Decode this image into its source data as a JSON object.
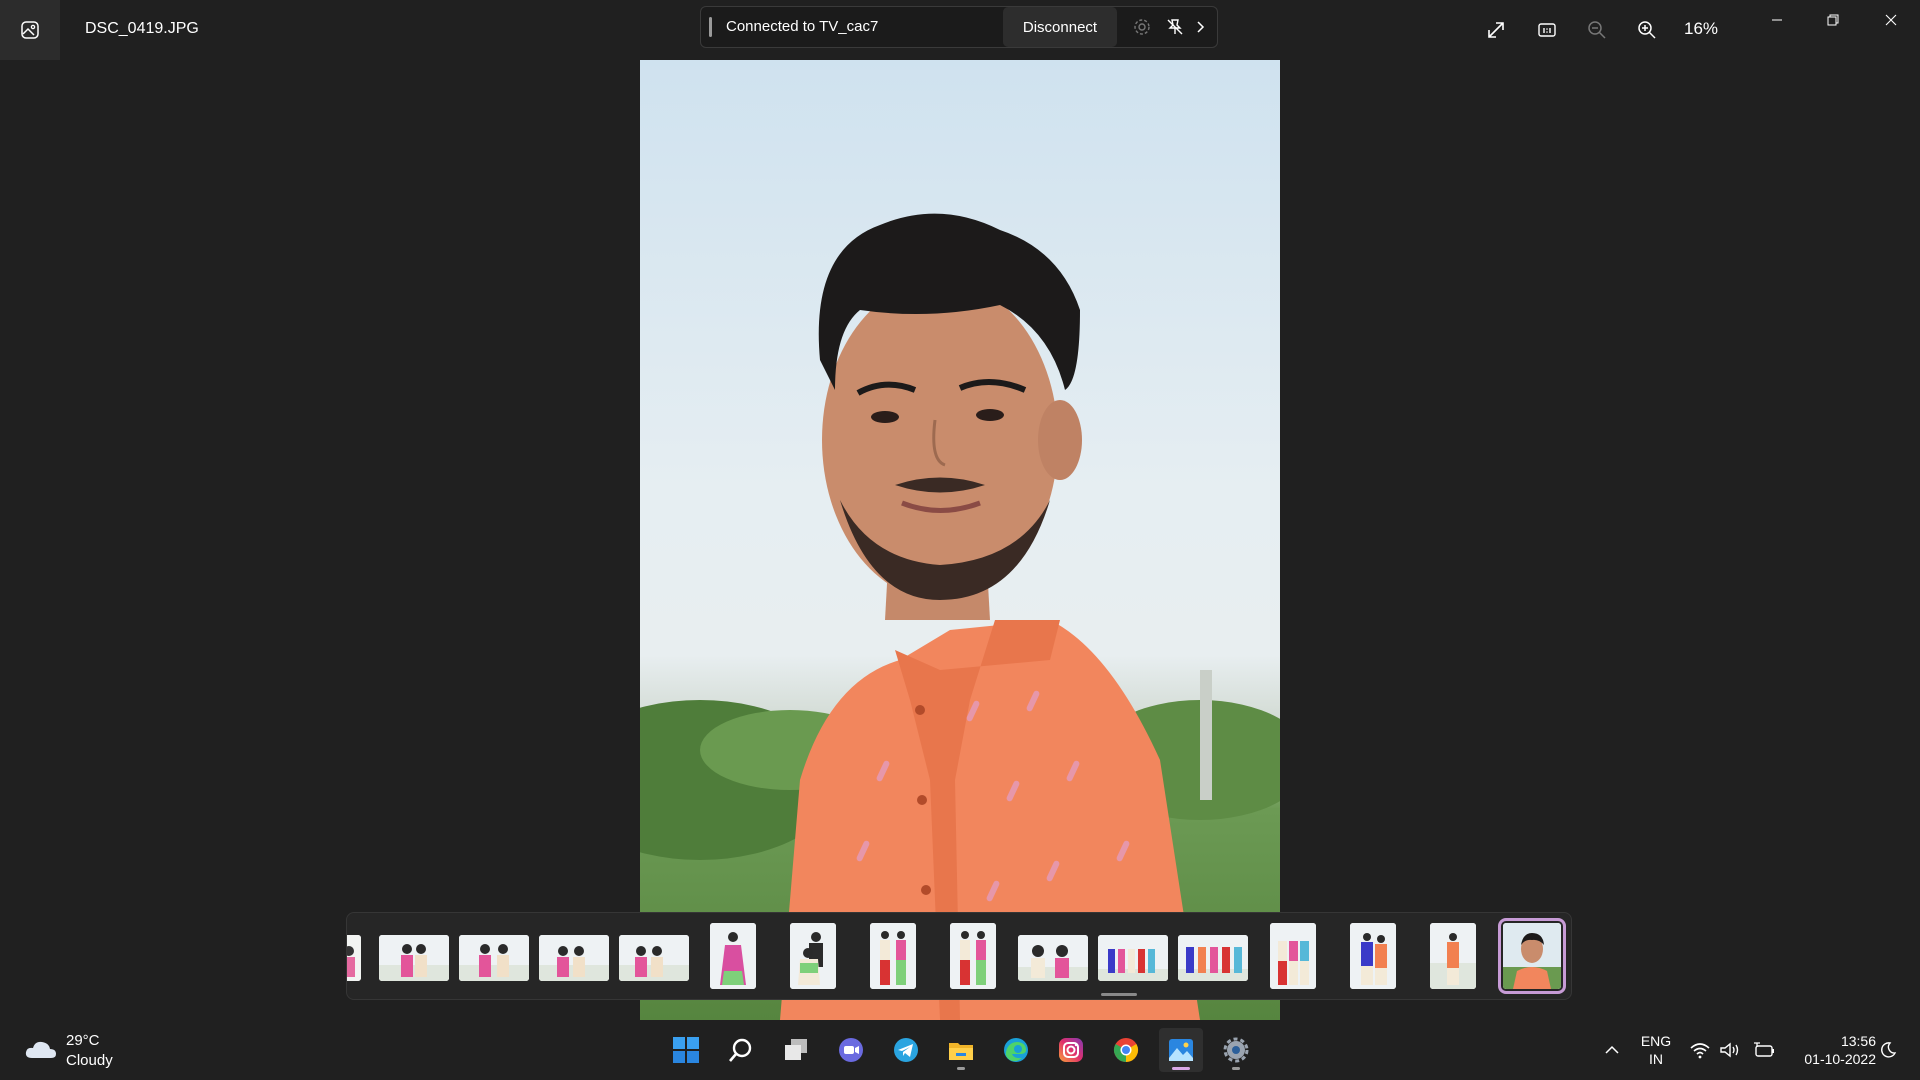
{
  "window": {
    "filename": "DSC_0419.JPG",
    "zoom": "16%"
  },
  "cast": {
    "status": "Connected to TV_cac7",
    "disconnect_label": "Disconnect"
  },
  "filmstrip": {
    "thumbnail_count": 17,
    "selected_index": 16
  },
  "taskbar": {
    "weather_temp": "29°C",
    "weather_condition": "Cloudy",
    "apps": [
      "start-icon",
      "search-icon",
      "task-view-icon",
      "teams-chat-icon",
      "telegram-icon",
      "file-explorer-icon",
      "edge-icon",
      "instagram-icon",
      "chrome-icon",
      "photos-icon",
      "settings-icon"
    ],
    "language_top": "ENG",
    "language_bottom": "IN",
    "time": "13:56",
    "date": "01-10-2022"
  },
  "colors": {
    "background": "#202020",
    "accent": "#d8a8e8",
    "shirt": "#f2865d"
  }
}
